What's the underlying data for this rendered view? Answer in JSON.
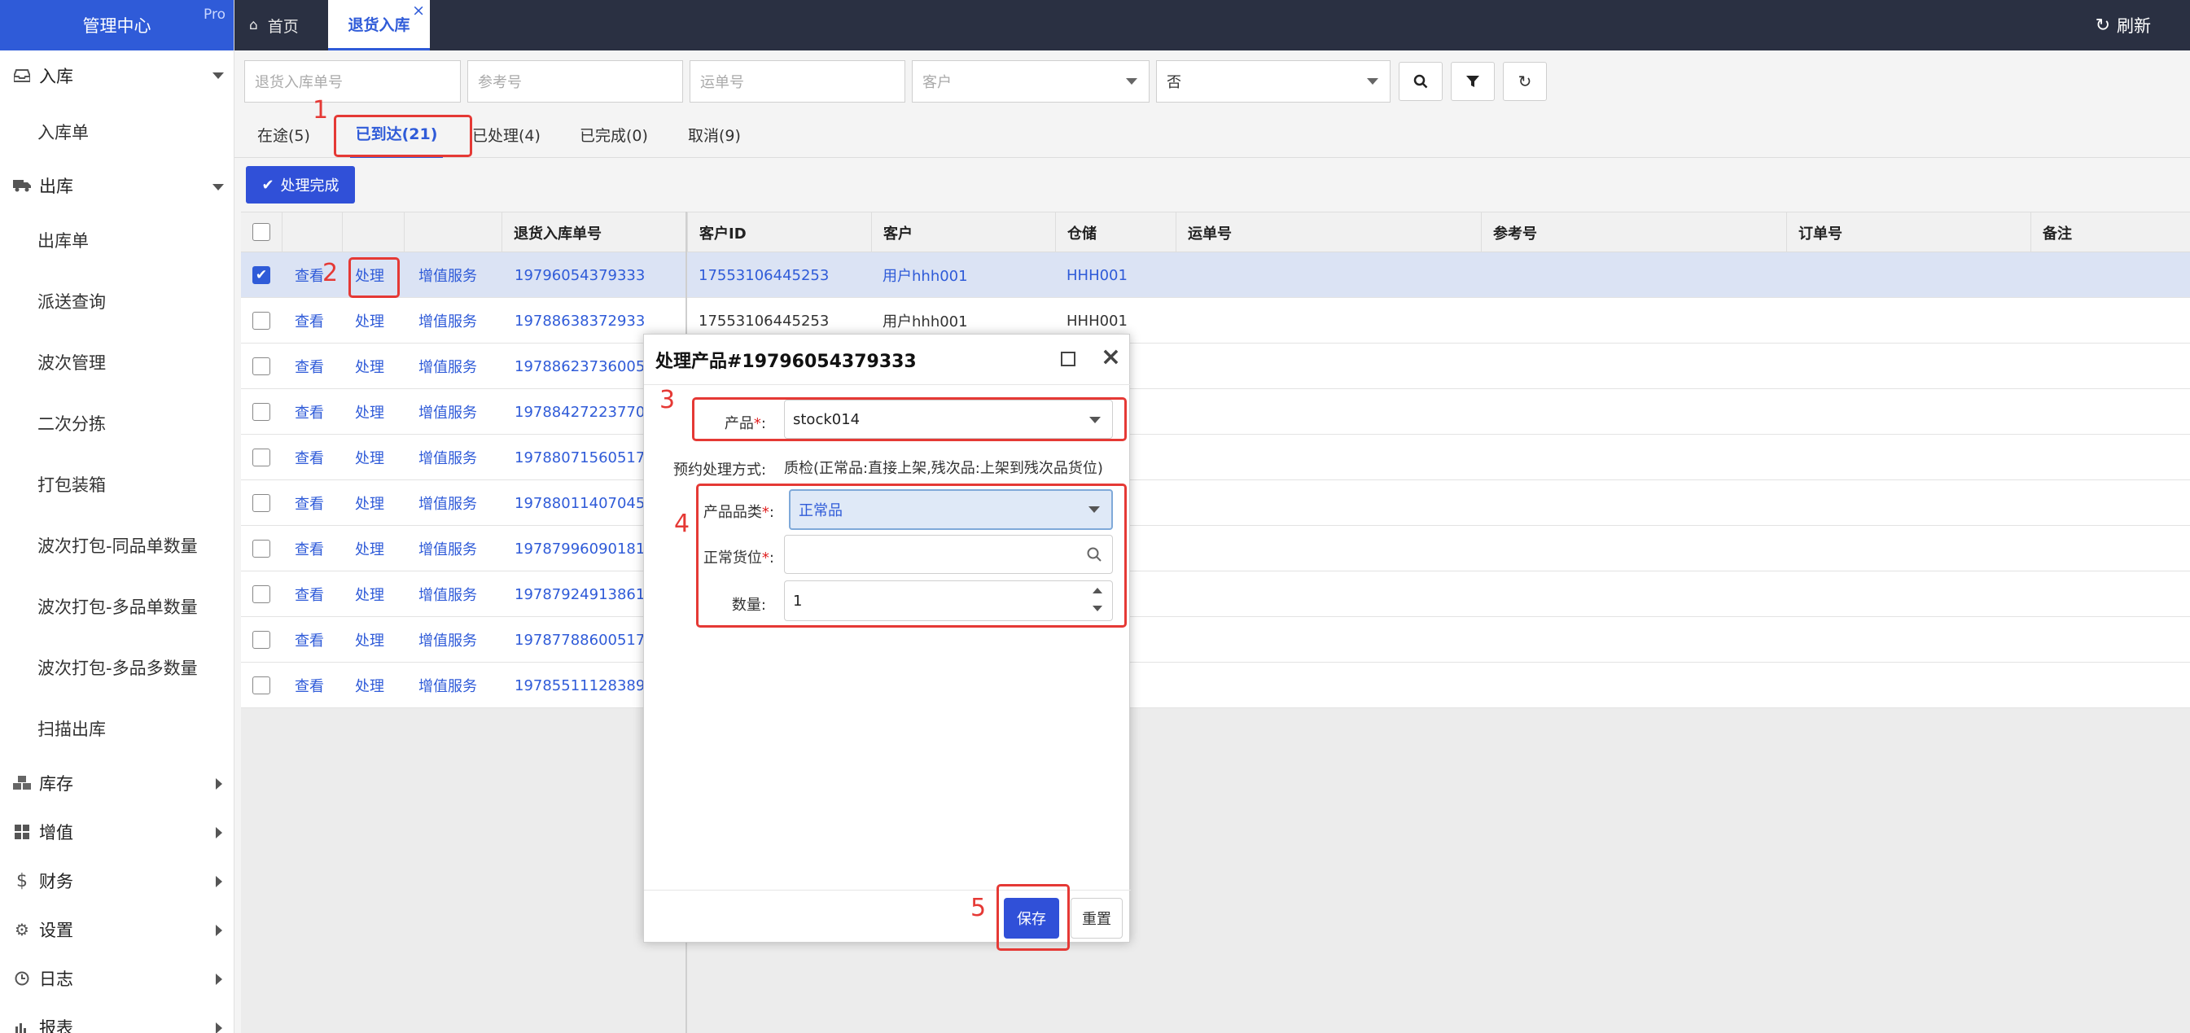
{
  "brand": {
    "title": "管理中心",
    "badge": "Pro"
  },
  "sidebar": {
    "groups": [
      {
        "label": "入库",
        "icon": "inbox-icon",
        "items": [
          "入库单"
        ]
      },
      {
        "label": "出库",
        "icon": "truck-icon",
        "items": [
          "出库单",
          "派送查询",
          "波次管理",
          "二次分拣",
          "打包装箱",
          "波次打包-同品单数量",
          "波次打包-多品单数量",
          "波次打包-多品多数量",
          "扫描出库"
        ]
      },
      {
        "label": "库存",
        "icon": "cubes-icon"
      },
      {
        "label": "增值",
        "icon": "grid-icon"
      },
      {
        "label": "财务",
        "icon": "dollar-icon"
      },
      {
        "label": "设置",
        "icon": "gears-icon"
      },
      {
        "label": "日志",
        "icon": "clock-icon"
      },
      {
        "label": "报表",
        "icon": "bar-chart-icon"
      }
    ]
  },
  "topbar": {
    "home": "首页",
    "active_tab": "退货入库",
    "refresh": "刷新"
  },
  "filters": {
    "return_no": "退货入库单号",
    "ref_no": "参考号",
    "tracking_no": "运单号",
    "customer": "客户",
    "flag_value": "否"
  },
  "status_tabs": [
    "在途(5)",
    "已到达(21)",
    "已处理(4)",
    "已完成(0)",
    "取消(9)"
  ],
  "actions": {
    "done": "处理完成"
  },
  "table": {
    "headers": {
      "return_no": "退货入库单号",
      "customer_id": "客户ID",
      "customer": "客户",
      "warehouse": "仓储",
      "tracking": "运单号",
      "ref": "参考号",
      "order": "订单号",
      "remark": "备注"
    },
    "row_actions": {
      "view": "查看",
      "process": "处理",
      "vas": "增值服务"
    },
    "rows": [
      {
        "no": "19796054379333",
        "customer_id": "17553106445253",
        "customer": "用户hhh001",
        "warehouse": "HHH001"
      },
      {
        "no": "19788638372933",
        "customer_id": "17553106445253",
        "customer": "用户hhh001",
        "warehouse": "HHH001"
      },
      {
        "no": "19788623736005",
        "customer_id": "",
        "customer": "",
        "warehouse": ""
      },
      {
        "no": "19788427223770",
        "customer_id": "",
        "customer": "",
        "warehouse": ""
      },
      {
        "no": "19788071560517",
        "customer_id": "",
        "customer": "",
        "warehouse": ""
      },
      {
        "no": "19788011407045",
        "customer_id": "",
        "customer": "",
        "warehouse": ""
      },
      {
        "no": "19787996090181",
        "customer_id": "",
        "customer": "",
        "warehouse": ""
      },
      {
        "no": "19787924913861",
        "customer_id": "",
        "customer": "",
        "warehouse": ""
      },
      {
        "no": "19787788600517",
        "customer_id": "",
        "customer": "",
        "warehouse": ""
      },
      {
        "no": "19785511128389",
        "customer_id": "",
        "customer": "",
        "warehouse": ""
      }
    ]
  },
  "modal": {
    "title": "处理产品#19796054379333",
    "product_label": "产品",
    "product_value": "stock014",
    "method_label": "预约处理方式:",
    "method_value": "质检(正常品:直接上架,残次品:上架到残次品货位)",
    "category_label": "产品品类",
    "category_value": "正常品",
    "location_label": "正常货位",
    "location_value": "",
    "qty_label": "数量:",
    "qty_value": "1",
    "save": "保存",
    "reset": "重置"
  },
  "annotations": [
    "1",
    "2",
    "3",
    "4",
    "5"
  ],
  "colors": {
    "accent": "#2f5bd8",
    "topbar": "#2a3042",
    "annotation": "#e53935"
  }
}
